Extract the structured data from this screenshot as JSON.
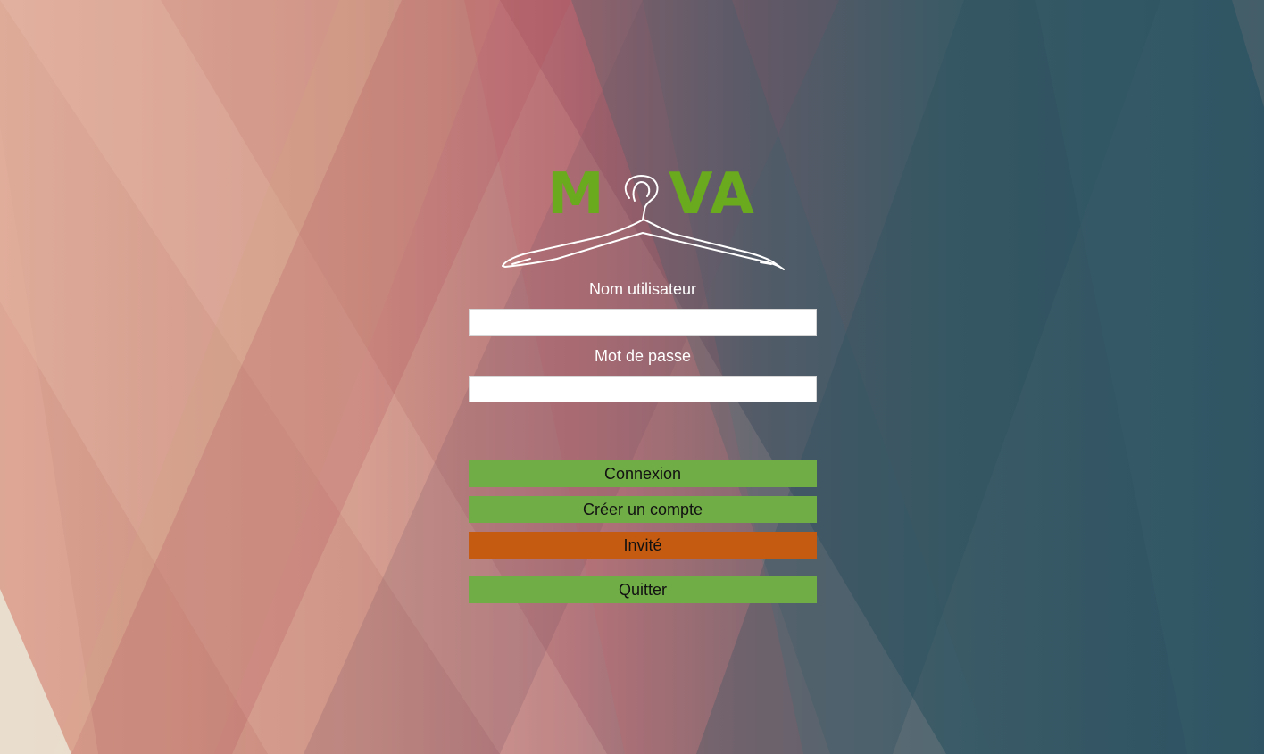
{
  "brand": {
    "logo_left": "M",
    "logo_right": "VA",
    "logo_color": "#6aaa1e",
    "logo_icon": "hanger-icon"
  },
  "login_form": {
    "username_label": "Nom utilisateur",
    "username_value": "",
    "password_label": "Mot de passe",
    "password_value": ""
  },
  "actions": {
    "connect_label": "Connexion",
    "create_account_label": "Créer un compte",
    "guest_label": "Invité",
    "quit_label": "Quitter"
  },
  "colors": {
    "primary_button": "#71ad47",
    "guest_button": "#c55a11",
    "label_text": "#ffffff"
  }
}
